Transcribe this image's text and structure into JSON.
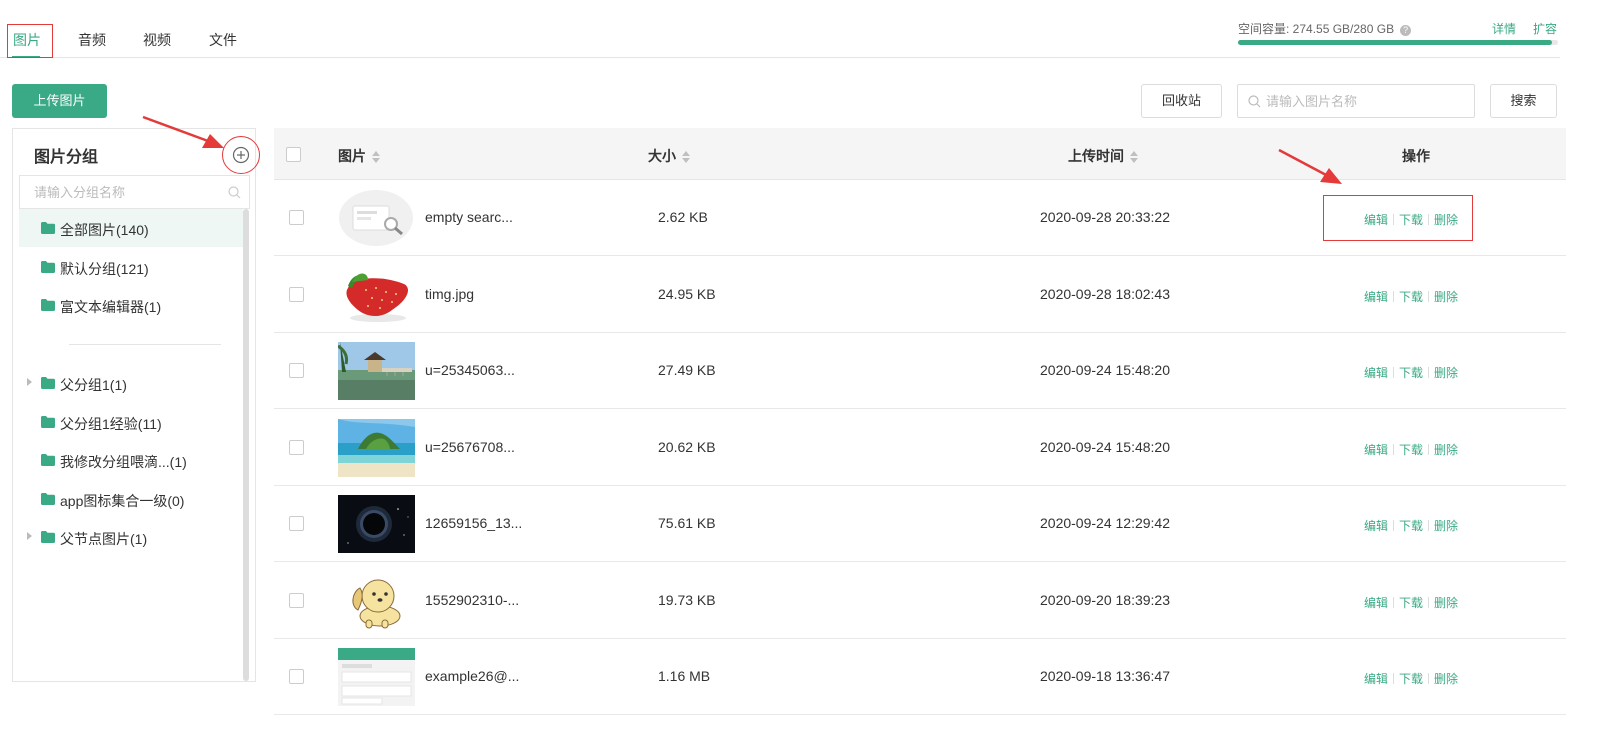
{
  "tabs": [
    {
      "label": "图片",
      "active": true
    },
    {
      "label": "音频",
      "active": false
    },
    {
      "label": "视频",
      "active": false
    },
    {
      "label": "文件",
      "active": false
    }
  ],
  "storage": {
    "label": "空间容量:  274.55 GB/280 GB",
    "used_fraction": 0.9805,
    "detail_link": "详情",
    "expand_link": "扩容"
  },
  "toolbar": {
    "upload_label": "上传图片",
    "recycle_label": "回收站",
    "search_placeholder": "请输入图片名称",
    "search_label": "搜索"
  },
  "sidebar": {
    "title": "图片分组",
    "search_placeholder": "请输入分组名称",
    "groups": [
      {
        "label": "全部图片(140)",
        "active": true,
        "expandable": false
      },
      {
        "label": "默认分组(121)",
        "active": false,
        "expandable": false
      },
      {
        "label": "富文本编辑器(1)",
        "active": false,
        "expandable": false
      },
      {
        "label": "父分组1(1)",
        "active": false,
        "expandable": true
      },
      {
        "label": "父分组1经验(11)",
        "active": false,
        "expandable": false
      },
      {
        "label": "我修改分组喂滴...(1)",
        "active": false,
        "expandable": false
      },
      {
        "label": "app图标集合一级(0)",
        "active": false,
        "expandable": false
      },
      {
        "label": "父节点图片(1)",
        "active": false,
        "expandable": true
      }
    ]
  },
  "table": {
    "headers": {
      "image": "图片",
      "size": "大小",
      "upload_time": "上传时间",
      "actions": "操作"
    },
    "action_labels": {
      "edit": "编辑",
      "download": "下载",
      "delete": "删除"
    },
    "rows": [
      {
        "name": "empty searc...",
        "size": "2.62 KB",
        "time": "2020-09-28 20:33:22",
        "thumb": "empty-search-illustration"
      },
      {
        "name": "timg.jpg",
        "size": "24.95 KB",
        "time": "2020-09-28 18:02:43",
        "thumb": "strawberry-photo"
      },
      {
        "name": "u=25345063...",
        "size": "27.49 KB",
        "time": "2020-09-24 15:48:20",
        "thumb": "pavilion-lake-photo"
      },
      {
        "name": "u=25676708...",
        "size": "20.62 KB",
        "time": "2020-09-24 15:48:20",
        "thumb": "island-beach-photo"
      },
      {
        "name": "12659156_13...",
        "size": "75.61 KB",
        "time": "2020-09-24 12:29:42",
        "thumb": "eclipse-photo"
      },
      {
        "name": "1552902310-...",
        "size": "19.73 KB",
        "time": "2020-09-20 18:39:23",
        "thumb": "cartoon-dog"
      },
      {
        "name": "example26@...",
        "size": "1.16 MB",
        "time": "2020-09-18 13:36:47",
        "thumb": "webpage-screenshot"
      }
    ]
  },
  "colors": {
    "accent": "#3aa986",
    "annotation": "#e43a3a"
  }
}
